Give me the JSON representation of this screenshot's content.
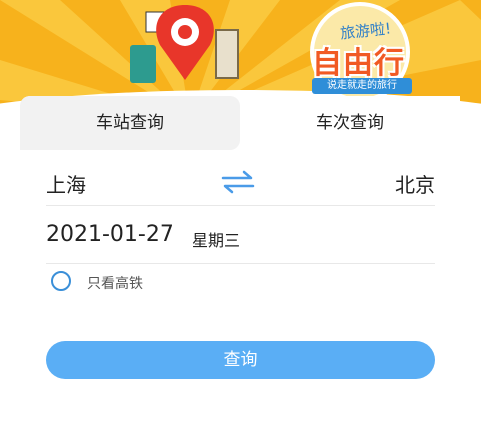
{
  "banner": {
    "slogan_title": "旅游啦!",
    "slogan_main": "自由行",
    "slogan_tag": "说走就走的旅行"
  },
  "tabs": [
    {
      "label": "车站查询",
      "active": true
    },
    {
      "label": "车次查询",
      "active": false
    }
  ],
  "route": {
    "from": "上海",
    "to": "北京",
    "swap_icon": "swap-arrows-icon"
  },
  "date": {
    "value": "2021-01-27",
    "weekday": "星期三"
  },
  "filter": {
    "label": "只看高铁",
    "checked": false
  },
  "query_button": "查询",
  "colors": {
    "banner": "#f7b21c",
    "accent": "#5aaef5",
    "swap": "#4a9be8"
  }
}
